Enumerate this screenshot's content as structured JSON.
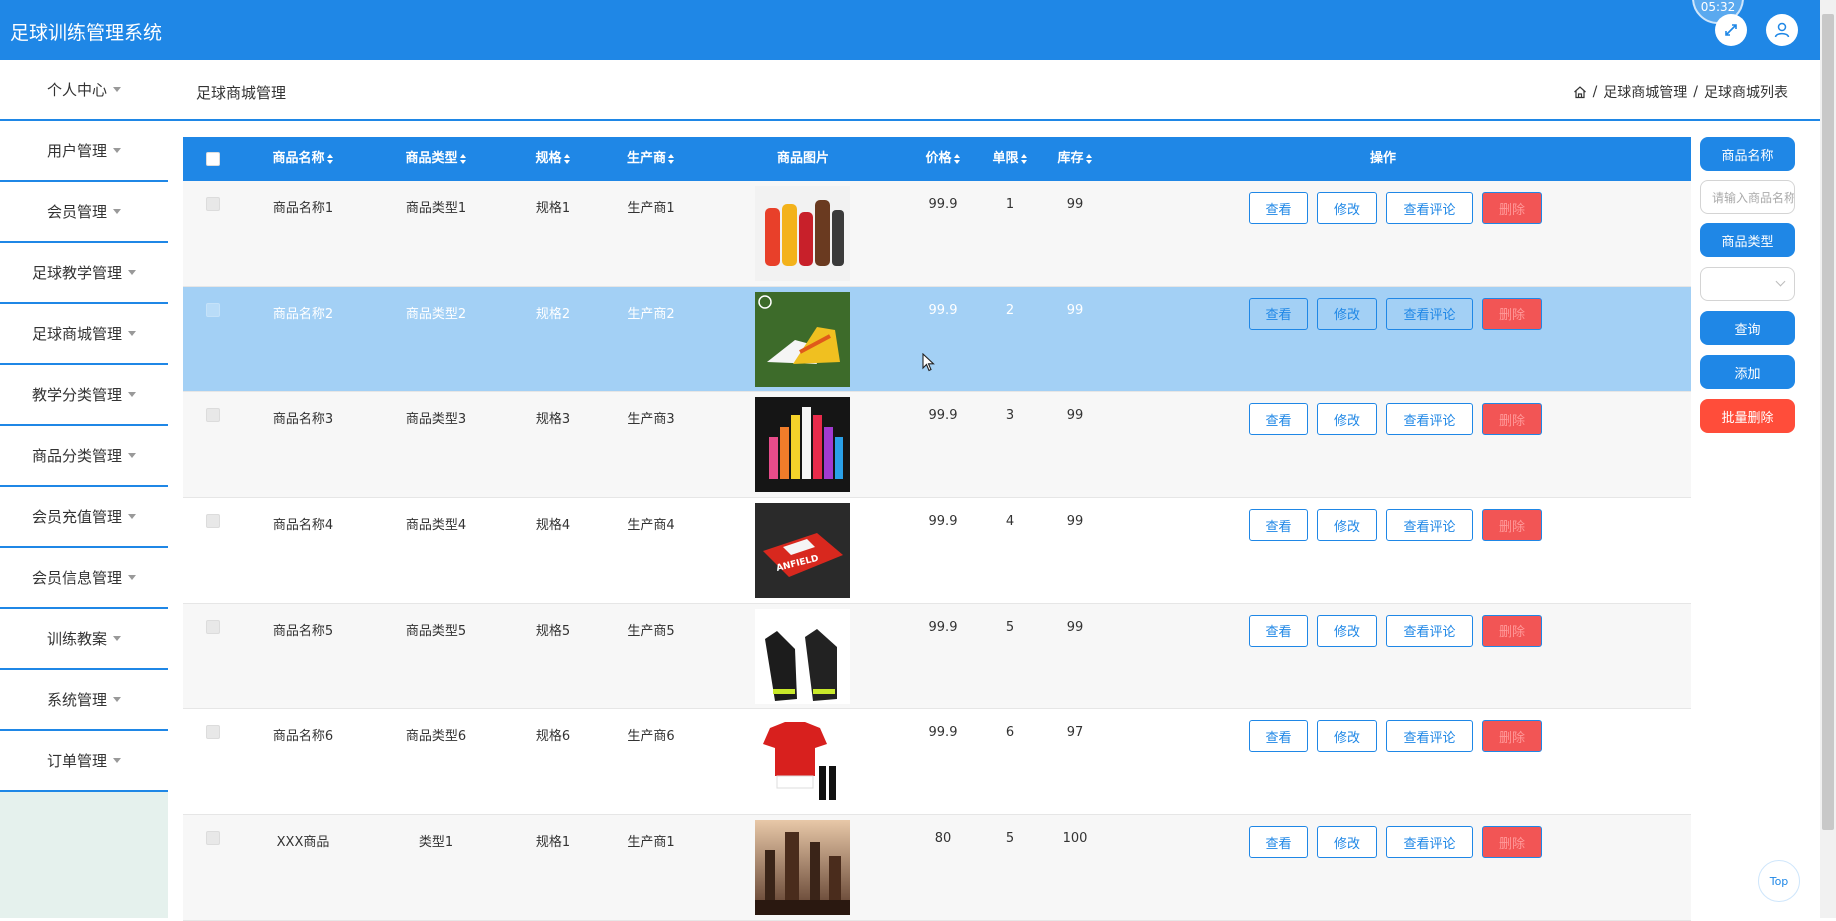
{
  "app": {
    "title": "足球训练管理系统",
    "clock": "05:32"
  },
  "sidebar": {
    "items": [
      {
        "label": "个人中心"
      },
      {
        "label": "用户管理"
      },
      {
        "label": "会员管理"
      },
      {
        "label": "足球教学管理"
      },
      {
        "label": "足球商城管理"
      },
      {
        "label": "教学分类管理"
      },
      {
        "label": "商品分类管理"
      },
      {
        "label": "会员充值管理"
      },
      {
        "label": "会员信息管理"
      },
      {
        "label": "训练教案"
      },
      {
        "label": "系统管理"
      },
      {
        "label": "订单管理"
      }
    ]
  },
  "header": {
    "title": "足球商城管理",
    "breadcrumb": [
      "足球商城管理",
      "足球商城列表"
    ],
    "sep": "/"
  },
  "table": {
    "headers": {
      "name": "商品名称",
      "type": "商品类型",
      "spec": "规格",
      "maker": "生产商",
      "image": "商品图片",
      "price": "价格",
      "limit": "单限",
      "stock": "库存",
      "ops": "操作"
    },
    "ops_labels": {
      "view": "查看",
      "edit": "修改",
      "comments": "查看评论",
      "delete": "删除"
    },
    "rows": [
      {
        "name": "商品名称1",
        "type": "商品类型1",
        "spec": "规格1",
        "maker": "生产商1",
        "price": "99.9",
        "limit": "1",
        "stock": "99",
        "image": "bottles"
      },
      {
        "name": "商品名称2",
        "type": "商品类型2",
        "spec": "规格2",
        "maker": "生产商2",
        "price": "99.9",
        "limit": "2",
        "stock": "99",
        "image": "boots"
      },
      {
        "name": "商品名称3",
        "type": "商品类型3",
        "spec": "规格3",
        "maker": "生产商3",
        "price": "99.9",
        "limit": "3",
        "stock": "99",
        "image": "drinks"
      },
      {
        "name": "商品名称4",
        "type": "商品类型4",
        "spec": "规格4",
        "maker": "生产商4",
        "price": "99.9",
        "limit": "4",
        "stock": "99",
        "image": "anfield-box"
      },
      {
        "name": "商品名称5",
        "type": "商品类型5",
        "spec": "规格5",
        "maker": "生产商5",
        "price": "99.9",
        "limit": "5",
        "stock": "99",
        "image": "gloves"
      },
      {
        "name": "商品名称6",
        "type": "商品类型6",
        "spec": "规格6",
        "maker": "生产商6",
        "price": "99.9",
        "limit": "6",
        "stock": "97",
        "image": "jersey"
      },
      {
        "name": "XXX商品",
        "type": "类型1",
        "spec": "规格1",
        "maker": "生产商1",
        "price": "80",
        "limit": "5",
        "stock": "100",
        "image": "city"
      }
    ]
  },
  "search_panel": {
    "name_label": "商品名称",
    "name_placeholder": "请输入商品名称",
    "type_label": "商品类型",
    "query": "查询",
    "add": "添加",
    "batch_delete": "批量删除"
  },
  "top_button": "Top",
  "images": {
    "anfield_text": "ANFIELD"
  },
  "colors": {
    "primary": "#1f87e6",
    "danger": "#f25555",
    "row_highlight": "#a3d0f5"
  }
}
